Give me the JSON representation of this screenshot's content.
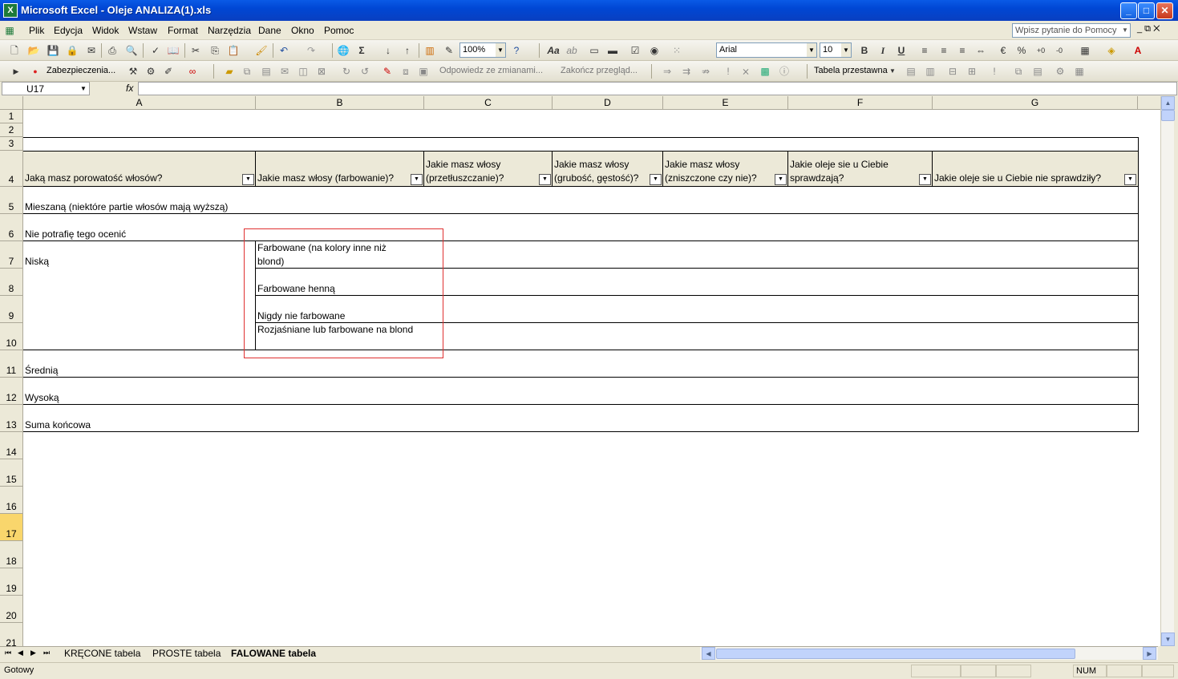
{
  "window": {
    "title": "Microsoft Excel - Oleje ANALIZA(1).xls",
    "min": "_",
    "max": "□",
    "close": "✕"
  },
  "menu": {
    "items": [
      "Plik",
      "Edycja",
      "Widok",
      "Wstaw",
      "Format",
      "Narzędzia",
      "Dane",
      "Okno",
      "Pomoc"
    ],
    "help_placeholder": "Wpisz pytanie do Pomocy",
    "mdi_controls": "_ ⧉ ✕"
  },
  "toolbar1": {
    "zoom": "100%",
    "font": "Arial",
    "size": "10",
    "bold": "B",
    "italic": "I",
    "underline": "U",
    "percent": "%"
  },
  "toolbar2": {
    "security": "Zabezpieczenia...",
    "reply": "Odpowiedz ze zmianami...",
    "end_review": "Zakończ przegląd...",
    "pivot": "Tabela przestawna"
  },
  "formula": {
    "name_box": "U17",
    "fx": "fx",
    "value": ""
  },
  "columns": [
    "A",
    "B",
    "C",
    "D",
    "E",
    "F",
    "G"
  ],
  "rows": [
    "1",
    "2",
    "3",
    "4",
    "5",
    "6",
    "7",
    "8",
    "9",
    "10",
    "11",
    "12",
    "13",
    "14",
    "15",
    "16",
    "17",
    "18",
    "19",
    "20",
    "21"
  ],
  "active_row": "17",
  "headers": {
    "a": "Jaką masz porowatość włosów?",
    "b": "Jakie masz włosy (farbowanie)?",
    "c": "Jakie masz włosy (przetłuszczanie)?",
    "d": "Jakie masz włosy (grubość, gęstość)?",
    "e": "Jakie masz włosy (zniszczone czy nie)?",
    "f": "Jakie oleje sie u Ciebie sprawdzają?",
    "g": "Jakie oleje sie u Ciebie nie sprawdziły?",
    "filter": "▼"
  },
  "data": {
    "r5": "Mieszaną (niektóre partie włosów mają wyższą)",
    "r6": "Nie potrafię tego ocenić",
    "r7a": "Niską",
    "r7b": "Farbowane (na kolory inne niż blond)",
    "r8b": "Farbowane henną",
    "r9b": "Nigdy nie farbowane",
    "r10b": "Rozjaśniane lub farbowane na blond",
    "r11": "Średnią",
    "r12": "Wysoką",
    "r13": "Suma końcowa"
  },
  "sheets": [
    "KRĘCONE tabela",
    "PROSTE tabela",
    "FALOWANE tabela"
  ],
  "active_sheet": "FALOWANE tabela",
  "status": {
    "text": "Gotowy",
    "num": "NUM"
  }
}
